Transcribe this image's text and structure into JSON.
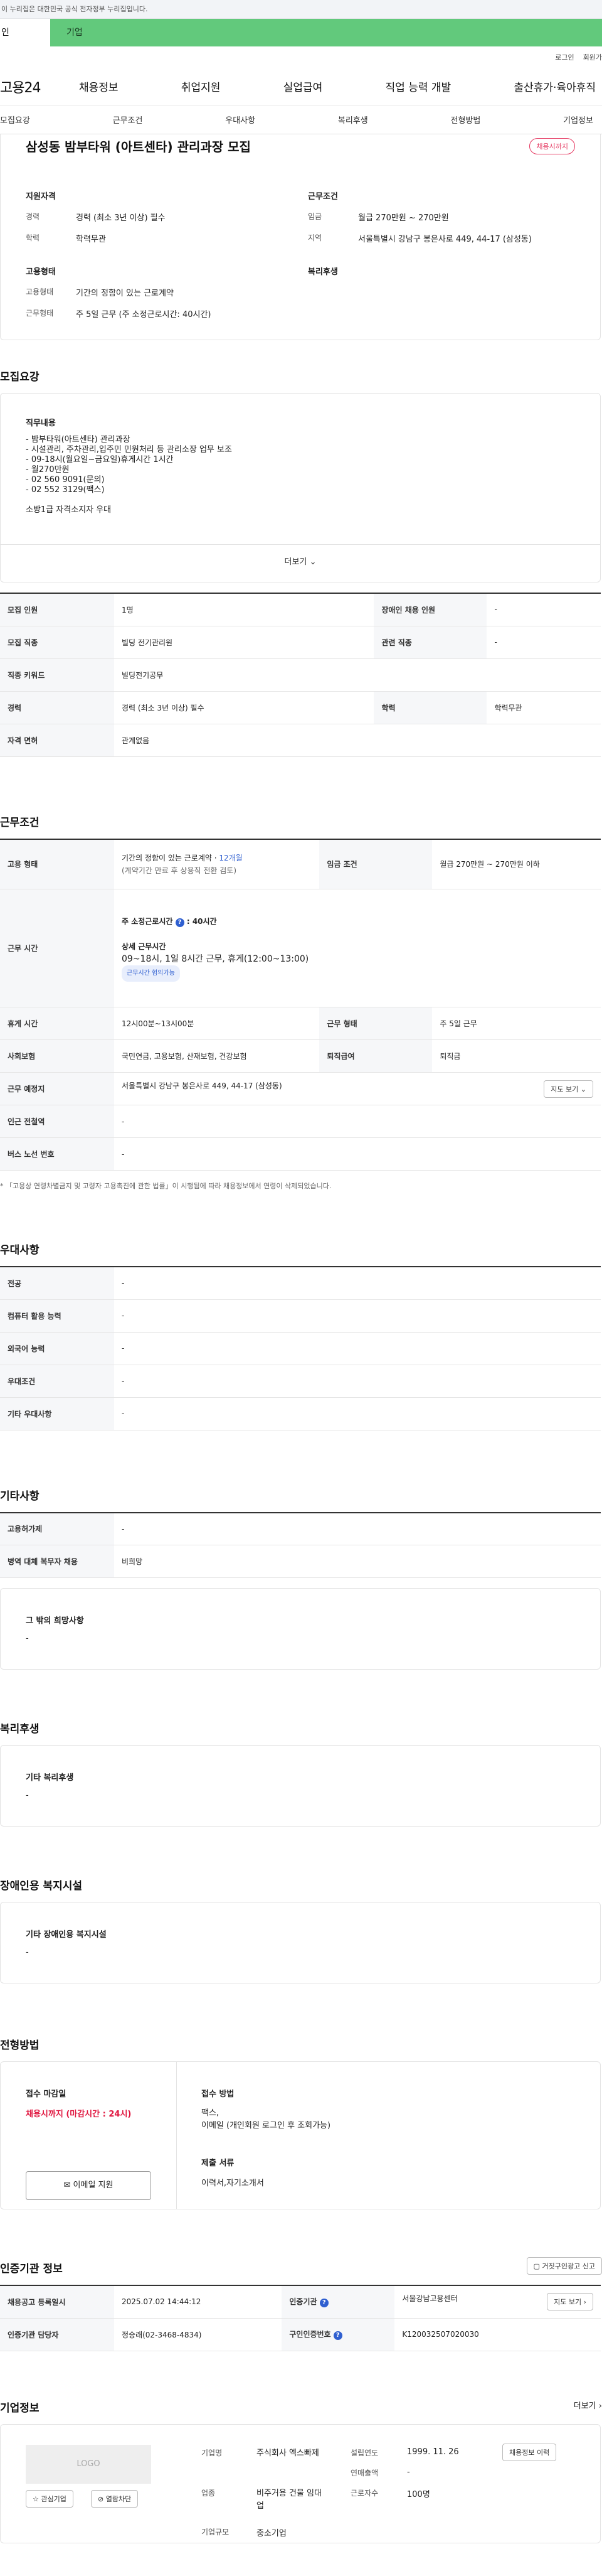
{
  "gov_banner": "이 누리집은 대한민국 공식 전자정부 누리집입니다.",
  "top_tabs": [
    "인",
    "기업"
  ],
  "util": {
    "login": "로그인",
    "join": "회원가"
  },
  "header": {
    "logo": "고용24",
    "menu": [
      "채용정보",
      "취업지원",
      "실업급여",
      "직업 능력 개발",
      "출산휴가·육아휴직"
    ]
  },
  "subnav": [
    "모집요강",
    "근무조건",
    "우대사항",
    "복리후생",
    "전형방법",
    "기업정보"
  ],
  "job": {
    "title": "삼성동 밤부타워 (아트센타) 관리과장 모집",
    "badge": "채용시까지",
    "qual_title": "지원자격",
    "cond_title": "근무조건",
    "career_label": "경력",
    "career_val": "경력 (최소 3년 이상) 필수",
    "edu_label": "학력",
    "edu_val": "학력무관",
    "wage_label": "임금",
    "wage_val": "월급 270만원 ~ 270만원",
    "region_label": "지역",
    "region_val": "서울특별시 강남구 봉은사로 449, 44-17 (삼성동)",
    "emp_title": "고용형태",
    "welfare_title": "복리후생",
    "emptype_label": "고용형태",
    "emptype_val": "기간의 정함이 있는 근로계약",
    "worktype_label": "근무형태",
    "worktype_val": "주 5일 근무 (주 소정근로시간: 40시간)"
  },
  "recruit": {
    "title": "모집요강",
    "duty_title": "직무내용",
    "duty_lines": [
      "- 밤부타워(아트센타) 관리과장",
      "- 시설관리, 주차관리,입주민 민원처리 등 관리소장 업무 보조",
      "- 09-18시(월요일~금요일)휴게시간 1시간",
      "- 월270만원",
      "- 02 560 9091(문의)",
      "- 02 552 3129(팩스)",
      "",
      "소방1급 자격소지자 우대"
    ],
    "more": "더보기",
    "rows": [
      {
        "k1": "모집 인원",
        "v1": "1명",
        "k2": "장애인 채용 인원",
        "v2": "-"
      },
      {
        "k1": "모집 직종",
        "v1": "빌딩 전기관리원",
        "k2": "관련 직종",
        "v2": "-"
      },
      {
        "k1": "직종 키워드",
        "v1": "빌딩전기공무",
        "k2": "",
        "v2": ""
      },
      {
        "k1": "경력",
        "v1": "경력 (최소 3년 이상) 필수",
        "k2": "학력",
        "v2": "학력무관"
      },
      {
        "k1": "자격 면허",
        "v1": "관계없음",
        "k2": "",
        "v2": ""
      }
    ]
  },
  "work": {
    "title": "근무조건",
    "emp_k": "고용 형태",
    "emp_v1": "기간의 정함이 있는 근로계약 · ",
    "emp_v1b": "12개월",
    "emp_v2": "(계약기간 만료 후 상용직 전환 검토)",
    "wage_k": "임금 조건",
    "wage_v": "월급 270만원 ~ 270만원 이하",
    "hours_k": "근무 시간",
    "hours_v1": "주 소정근로시간",
    "hours_v1b": ": 40시간",
    "hours_d": "상세 근무시간",
    "hours_v2": "09~18시, 1일 8시간 근무, 휴게(12:00~13:00)",
    "hours_pill": "근무시간 협의가능",
    "rest_k": "휴게 시간",
    "rest_v": "12시00분~13시00분",
    "form_k": "근무 형태",
    "form_v": "주 5일 근무",
    "ins_k": "사회보험",
    "ins_v": "국민연금, 고용보험, 산재보험, 건강보험",
    "sev_k": "퇴직급여",
    "sev_v": "퇴직금",
    "place_k": "근무 예정지",
    "place_v": "서울특별시 강남구 봉은사로 449, 44-17 (삼성동)",
    "map_btn": "지도 보기",
    "subway_k": "인근 전철역",
    "subway_v": "-",
    "bus_k": "버스 노선 번호",
    "bus_v": "-",
    "note": "* 「고용상 연령차별금지 및 고령자 고용촉진에 관한 법률」이 시행됨에 따라 채용정보에서 연령이 삭제되었습니다."
  },
  "pref": {
    "title": "우대사항",
    "rows": [
      [
        "전공",
        "-"
      ],
      [
        "컴퓨터 활용 능력",
        "-"
      ],
      [
        "외국어 능력",
        "-"
      ],
      [
        "우대조건",
        "-"
      ],
      [
        "기타 우대사항",
        "-"
      ]
    ]
  },
  "etc": {
    "title": "기타사항",
    "rows": [
      [
        "고용허가제",
        "-"
      ],
      [
        "병역 대체 복무자 채용",
        "비희망"
      ]
    ],
    "box_title": "그 밖의 희망사항",
    "box_val": "-"
  },
  "benefit": {
    "title": "복리후생",
    "box_title": "기타 복리후생",
    "box_val": "-"
  },
  "disab": {
    "title": "장애인용 복지시설",
    "box_title": "기타 장애인용 복지시설",
    "box_val": "-"
  },
  "select": {
    "title": "전형방법",
    "deadline_t": "접수 마감일",
    "deadline_v": "채용시까지 (마감시간 : 24시)",
    "apply_btn": "이메일 지원",
    "method_t": "접수 방법",
    "method_v1": "팩스,",
    "method_v2": "이메일 (개인회원 로그인 후 조회가능)",
    "docs_t": "제출 서류",
    "docs_v": "이력서,자기소개서"
  },
  "cert": {
    "title": "인증기관 정보",
    "report_btn": "거짓구인광고 신고",
    "rows": [
      {
        "k1": "채용공고 등록일시",
        "v1": "2025.07.02 14:44:12",
        "k2": "인증기관",
        "v2": "서울강남고용센터",
        "btn": "지도 보기"
      },
      {
        "k1": "인증기관 담당자",
        "v1": "정승래(02-3468-4834)",
        "k2": "구인인증번호",
        "v2": "K120032507020030",
        "btn": ""
      }
    ]
  },
  "company": {
    "title": "기업정보",
    "more": "더보기",
    "logo": "LOGO",
    "fav": "관심기업",
    "block": "열람차단",
    "name_k": "기업명",
    "name_v": "주식회사 엑스빠제",
    "ind_k": "업종",
    "ind_v": "비주거용 건물 임대업",
    "size_k": "기업규모",
    "size_v": "중소기업",
    "est_k": "설립연도",
    "est_v": "1999. 11. 26",
    "sales_k": "연매출액",
    "sales_v": "-",
    "emp_k": "근로자수",
    "emp_v": "100명",
    "jobs_btn": "채용정보 이력"
  }
}
